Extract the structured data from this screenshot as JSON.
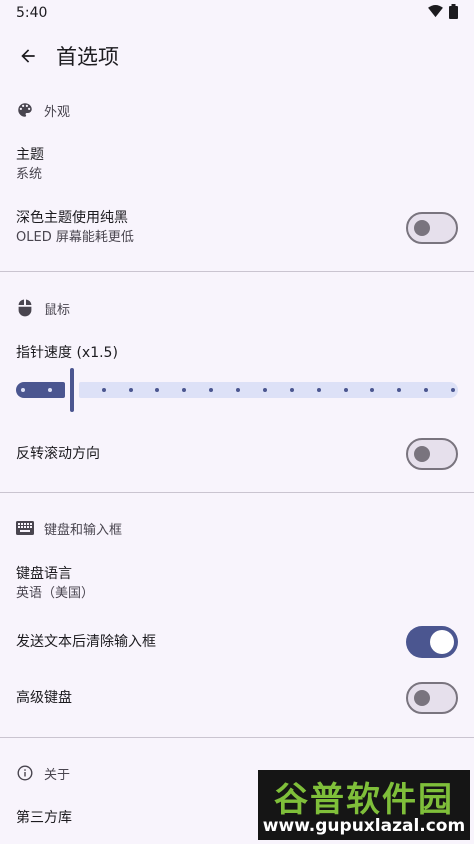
{
  "status_bar": {
    "time": "5:40",
    "icons": [
      "wifi-icon",
      "battery-icon"
    ]
  },
  "app_bar": {
    "back_icon": "arrow-back-icon",
    "title": "首选项"
  },
  "sections": {
    "appearance": {
      "icon": "palette-icon",
      "title": "外观",
      "theme": {
        "title": "主题",
        "summary": "系统"
      },
      "pure_black": {
        "title": "深色主题使用纯黑",
        "summary": "OLED 屏幕能耗更低",
        "enabled": false
      }
    },
    "mouse": {
      "icon": "mouse-icon",
      "title": "鼠标",
      "pointer_speed": {
        "title": "指针速度 (x1.5)",
        "value": 1.5,
        "steps": 17,
        "selected_step": 2
      },
      "reverse_scroll": {
        "title": "反转滚动方向",
        "enabled": false
      }
    },
    "keyboard": {
      "icon": "keyboard-icon",
      "title": "键盘和输入框",
      "language": {
        "title": "键盘语言",
        "summary": "英语（美国）"
      },
      "clear_after_send": {
        "title": "发送文本后清除输入框",
        "enabled": true
      },
      "advanced": {
        "title": "高级键盘",
        "enabled": false
      }
    },
    "about": {
      "icon": "info-icon",
      "title": "关于",
      "third_party": {
        "title": "第三方库"
      }
    }
  },
  "watermark": {
    "brand": "谷普软件园",
    "url": "www.gupuxlazal.com"
  },
  "colors": {
    "accent": "#4b5690",
    "background": "#f8f4fc",
    "track": "#dde1f7"
  }
}
